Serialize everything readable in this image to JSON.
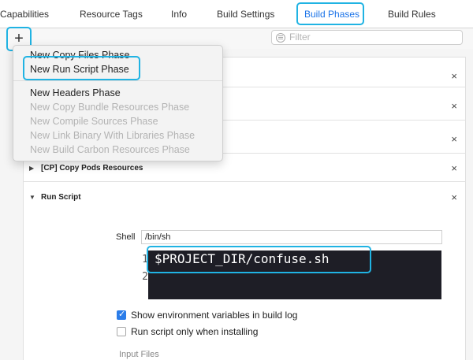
{
  "tabs": [
    {
      "label": "Capabilities"
    },
    {
      "label": "Resource Tags"
    },
    {
      "label": "Info"
    },
    {
      "label": "Build Settings"
    },
    {
      "label": "Build Phases"
    },
    {
      "label": "Build Rules"
    }
  ],
  "toolbar": {
    "add_symbol": "+",
    "filter_placeholder": "Filter"
  },
  "menu": {
    "items": [
      {
        "label": "New Copy Files Phase",
        "enabled": true
      },
      {
        "label": "New Run Script Phase",
        "enabled": true
      },
      {
        "label": "New Headers Phase",
        "enabled": true
      },
      {
        "label": "New Copy Bundle Resources Phase",
        "enabled": false
      },
      {
        "label": "New Compile Sources Phase",
        "enabled": false
      },
      {
        "label": "New Link Binary With Libraries Phase",
        "enabled": false
      },
      {
        "label": "New Build Carbon Resources Phase",
        "enabled": false
      }
    ]
  },
  "phases": {
    "copy_pods": {
      "title": "[CP] Copy Pods Resources"
    },
    "run_script": {
      "title": "Run Script"
    }
  },
  "run_script": {
    "shell_label": "Shell",
    "shell_value": "/bin/sh",
    "line_numbers": [
      "1",
      "2"
    ],
    "code_line": "$PROJECT_DIR/confuse.sh",
    "show_env_label": "Show environment variables in build log",
    "show_env_checked": true,
    "only_installing_label": "Run script only when installing",
    "only_installing_checked": false,
    "input_files_label": "Input Files"
  },
  "icons": {
    "close": "×",
    "expand_collapsed": "▶",
    "expand_open": "▼"
  },
  "colors": {
    "highlight": "#20b3e3",
    "active_tab": "#1a73e8",
    "editor_bg": "#1e1e26"
  }
}
